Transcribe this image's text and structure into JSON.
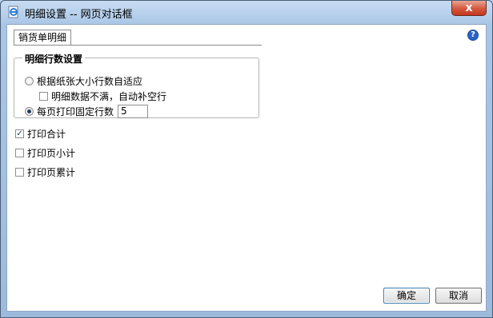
{
  "window": {
    "title": "明细设置 -- 网页对话框"
  },
  "tabs": [
    {
      "label": "销货单明细"
    }
  ],
  "group": {
    "legend": "明细行数设置"
  },
  "options": {
    "auto_fit_label": "根据纸张大小行数自适应",
    "fill_blank_label": "明细数据不满，自动补空行",
    "fixed_rows_label": "每页打印固定行数",
    "fixed_rows_value": "5"
  },
  "checks": {
    "print_total": {
      "label": "打印合计",
      "checked": true
    },
    "print_page_subtotal": {
      "label": "打印页小计",
      "checked": false
    },
    "print_page_cumulative": {
      "label": "打印页累计",
      "checked": false
    }
  },
  "buttons": {
    "ok": "确定",
    "cancel": "取消",
    "close": "x"
  },
  "icons": {
    "help": "?"
  }
}
